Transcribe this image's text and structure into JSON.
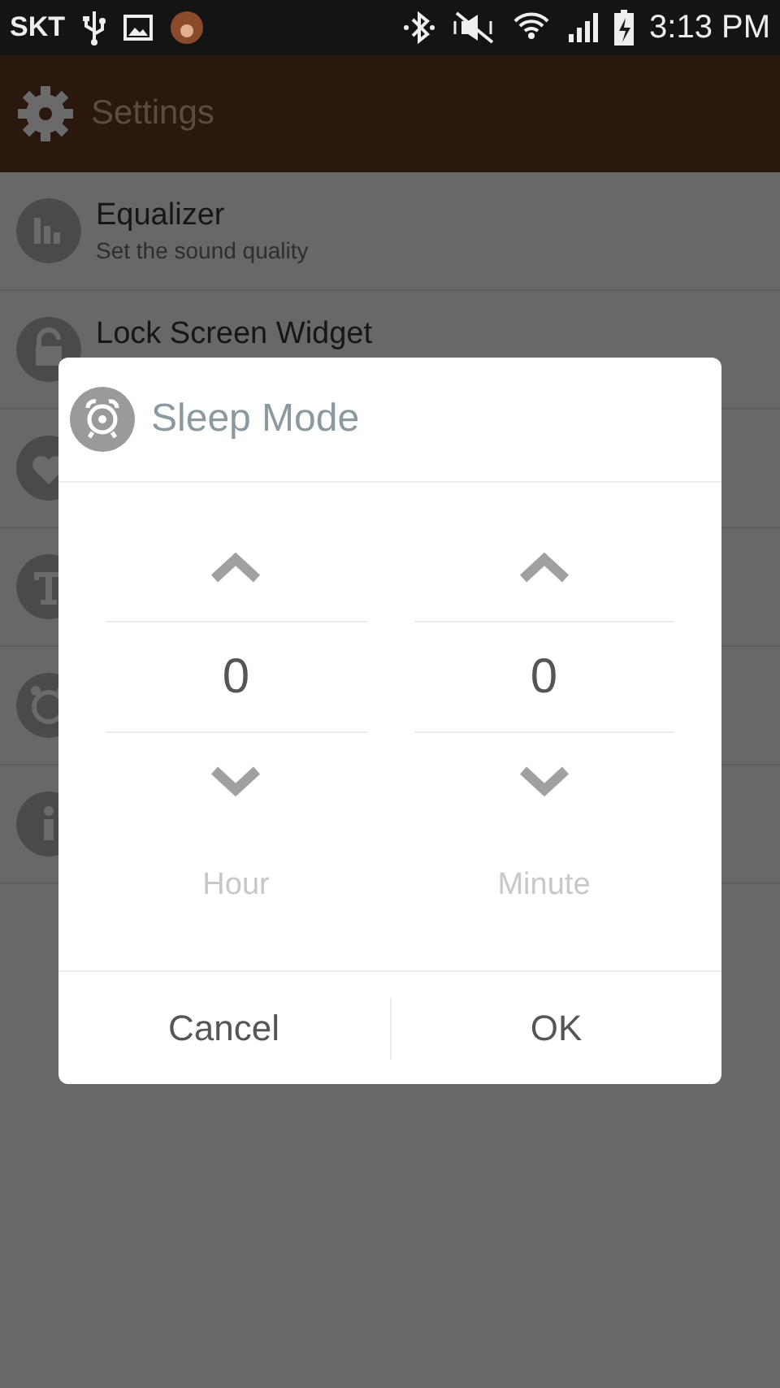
{
  "status_bar": {
    "carrier": "SKT",
    "time": "3:13 PM"
  },
  "app_bar": {
    "title": "Settings"
  },
  "settings_items": [
    {
      "title": "Equalizer",
      "subtitle": "Set the sound quality"
    },
    {
      "title": "Lock Screen Widget"
    }
  ],
  "dialog": {
    "title": "Sleep Mode",
    "pickers": [
      {
        "value": "0",
        "label": "Hour"
      },
      {
        "value": "0",
        "label": "Minute"
      }
    ],
    "buttons": [
      "Cancel",
      "OK"
    ]
  }
}
